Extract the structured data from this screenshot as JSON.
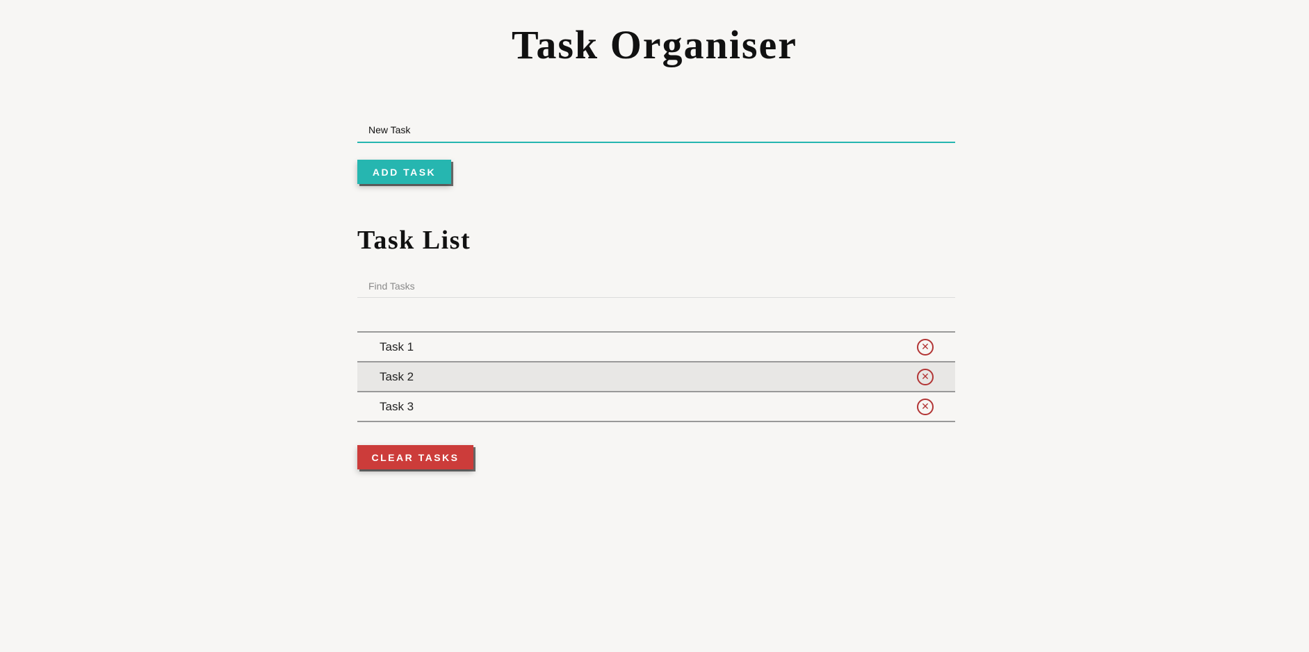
{
  "app": {
    "title": "Task Organiser"
  },
  "new_task": {
    "value": "New Task",
    "placeholder": "New Task"
  },
  "add_button": {
    "label": "ADD TASK"
  },
  "task_list": {
    "title": "Task List",
    "filter": {
      "placeholder": "Find Tasks",
      "value": ""
    },
    "items": [
      {
        "label": "Task 1",
        "delete_icon": "x-circle-icon",
        "glyph": "✕"
      },
      {
        "label": "Task 2",
        "delete_icon": "x-circle-icon",
        "glyph": "✕"
      },
      {
        "label": "Task 3",
        "delete_icon": "x-circle-icon",
        "glyph": "✕"
      }
    ]
  },
  "clear_button": {
    "label": "CLEAR TASKS"
  },
  "colors": {
    "accent": "#26b6b0",
    "danger": "#cc3c3a",
    "background": "#f7f6f4"
  }
}
